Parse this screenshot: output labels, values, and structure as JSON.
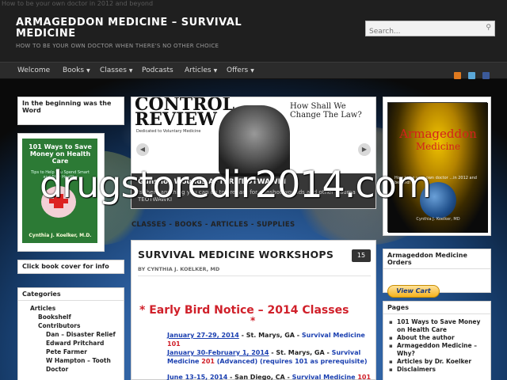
{
  "top_tagline": "How to be your own doctor in 2012 and beyond",
  "site": {
    "title": "ARMAGEDDON MEDICINE – SURVIVAL MEDICINE",
    "description": "HOW TO BE YOUR OWN DOCTOR WHEN THERE'S NO OTHER CHOICE"
  },
  "search": {
    "placeholder": "Search..."
  },
  "nav": {
    "items": [
      {
        "label": "Welcome"
      },
      {
        "label": "Books"
      },
      {
        "label": "Classes"
      },
      {
        "label": "Podcasts"
      },
      {
        "label": "Articles"
      },
      {
        "label": "Offers"
      }
    ]
  },
  "left": {
    "widget1_title": "In the beginning was the Word",
    "book": {
      "title": "101 Ways to Save Money on Health Care",
      "subtitle": "Tips to Help You Spend Smart and Stay Healthy",
      "author": "Cynthia J. Koelker, M.D."
    },
    "click_info": "Click book cover for info",
    "categories_title": "Categories",
    "categories": [
      {
        "label": "Articles",
        "level": 1
      },
      {
        "label": "Bookshelf",
        "level": 2
      },
      {
        "label": "Contributors",
        "level": 2
      },
      {
        "label": "Dan – Disaster Relief",
        "level": 3
      },
      {
        "label": "Edward Pritchard",
        "level": 3
      },
      {
        "label": "Pete Farmer",
        "level": 3
      },
      {
        "label": "W Hampton – Tooth Doctor",
        "level": 3
      }
    ]
  },
  "slider": {
    "magazine_title_1": "CONTROL",
    "magazine_title_2": "REVIEW",
    "magazine_sub": "Dedicated to Voluntary Medicine",
    "magazine_question": "How Shall We Change The Law?",
    "caption_title": "Gunshot Wounds AFTER TEOTWAWKI",
    "caption_desc": "Is there anything you can do to prepare for gunshot wounds and other trauma TEOTWAWKI"
  },
  "breadcrumb": "CLASSES - BOOKS - ARTICLES - SUPPLIES",
  "post": {
    "title": "SURVIVAL MEDICINE WORKSHOPS",
    "comments": "15",
    "byline": "BY CYNTHIA J. KOELKER, MD",
    "notice": "*  Early Bird Notice – 2014 Classes",
    "notice_star": "*",
    "schedule": [
      {
        "date": "January 27-29, 2014",
        "place": " - St. Marys, GA - ",
        "course": "Survival Medicine",
        "num": " 101",
        "extra": ""
      },
      {
        "date": "January 30-February 1, 2014",
        "place": " - St. Marys, GA - ",
        "course": "Survival Medicine",
        "num": " 201",
        "extra": " (Advanced) (requires 101 as prerequisite)"
      },
      {
        "date": "June 13-15, 2014",
        "place": " - San Diego, CA - ",
        "course": "Survival Medicine",
        "num": " 101",
        "extra": ""
      }
    ]
  },
  "right": {
    "book": {
      "title_1": "Armageddon",
      "title_2": "Medicine",
      "blurb": "How to be your own doctor ...in 2012 and beyond!",
      "author": "Cynthia J. Koelker, MD"
    },
    "orders_title": "Armageddon Medicine Orders",
    "view_cart": "View Cart",
    "pages_title": "Pages",
    "pages": [
      "101 Ways to Save Money on Health Care",
      "About the author",
      "Armageddon Medicine – Why?",
      "Articles by Dr. Koelker",
      "Disclaimers"
    ]
  },
  "watermark": "drugstoredir2014.com",
  "colors": {
    "accent_red": "#d0202a",
    "link_blue": "#1a3fb0",
    "header_bg": "#1f1f1f"
  }
}
